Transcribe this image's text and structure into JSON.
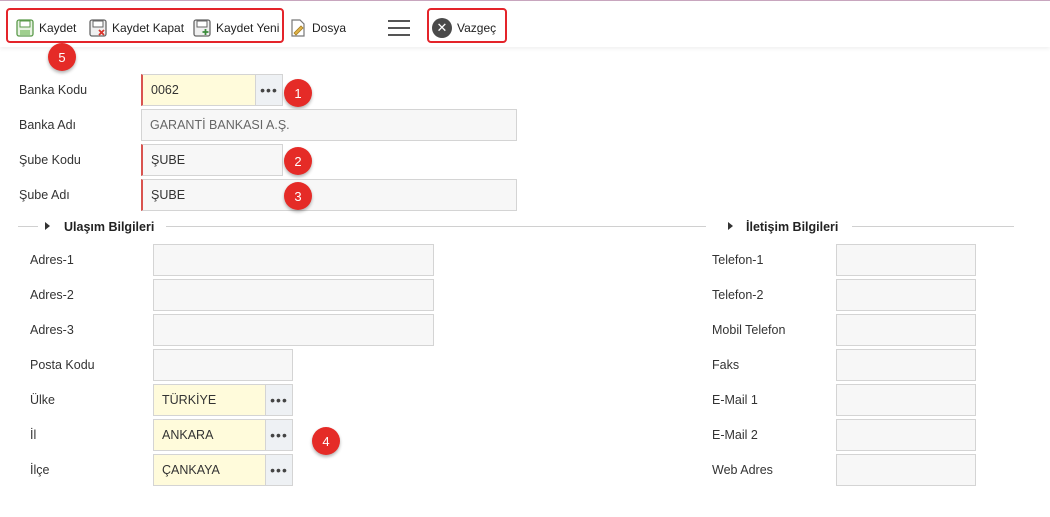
{
  "toolbar": {
    "save_label": "Kaydet",
    "save_close_label": "Kaydet Kapat",
    "save_new_label": "Kaydet Yeni",
    "file_label": "Dosya",
    "cancel_label": "Vazgeç"
  },
  "badges": {
    "b1": "1",
    "b2": "2",
    "b3": "3",
    "b4": "4",
    "b5": "5"
  },
  "bank": {
    "code_label": "Banka Kodu",
    "code_value": "0062",
    "name_label": "Banka Adı",
    "name_value": "GARANTİ BANKASI A.Ş.",
    "branch_code_label": "Şube Kodu",
    "branch_code_value": "ŞUBE",
    "branch_name_label": "Şube Adı",
    "branch_name_value": "ŞUBE"
  },
  "address": {
    "section_title": "Ulaşım Bilgileri",
    "address1_label": "Adres-1",
    "address1_value": "",
    "address2_label": "Adres-2",
    "address2_value": "",
    "address3_label": "Adres-3",
    "address3_value": "",
    "postal_label": "Posta Kodu",
    "postal_value": "",
    "country_label": "Ülke",
    "country_value": "TÜRKİYE",
    "city_label": "İl",
    "city_value": "ANKARA",
    "district_label": "İlçe",
    "district_value": "ÇANKAYA"
  },
  "contact": {
    "section_title": "İletişim Bilgileri",
    "phone1_label": "Telefon-1",
    "phone2_label": "Telefon-2",
    "mobile_label": "Mobil Telefon",
    "fax_label": "Faks",
    "email1_label": "E-Mail 1",
    "email2_label": "E-Mail 2",
    "web_label": "Web Adres"
  },
  "colors": {
    "accent_red": "#e52b27",
    "lookup_yellow": "#fffbdb"
  },
  "icons": [
    "save-icon",
    "save-close-icon",
    "save-new-icon",
    "file-icon",
    "menu-icon",
    "cancel-icon",
    "ellipsis-icon",
    "caret-right-icon"
  ]
}
